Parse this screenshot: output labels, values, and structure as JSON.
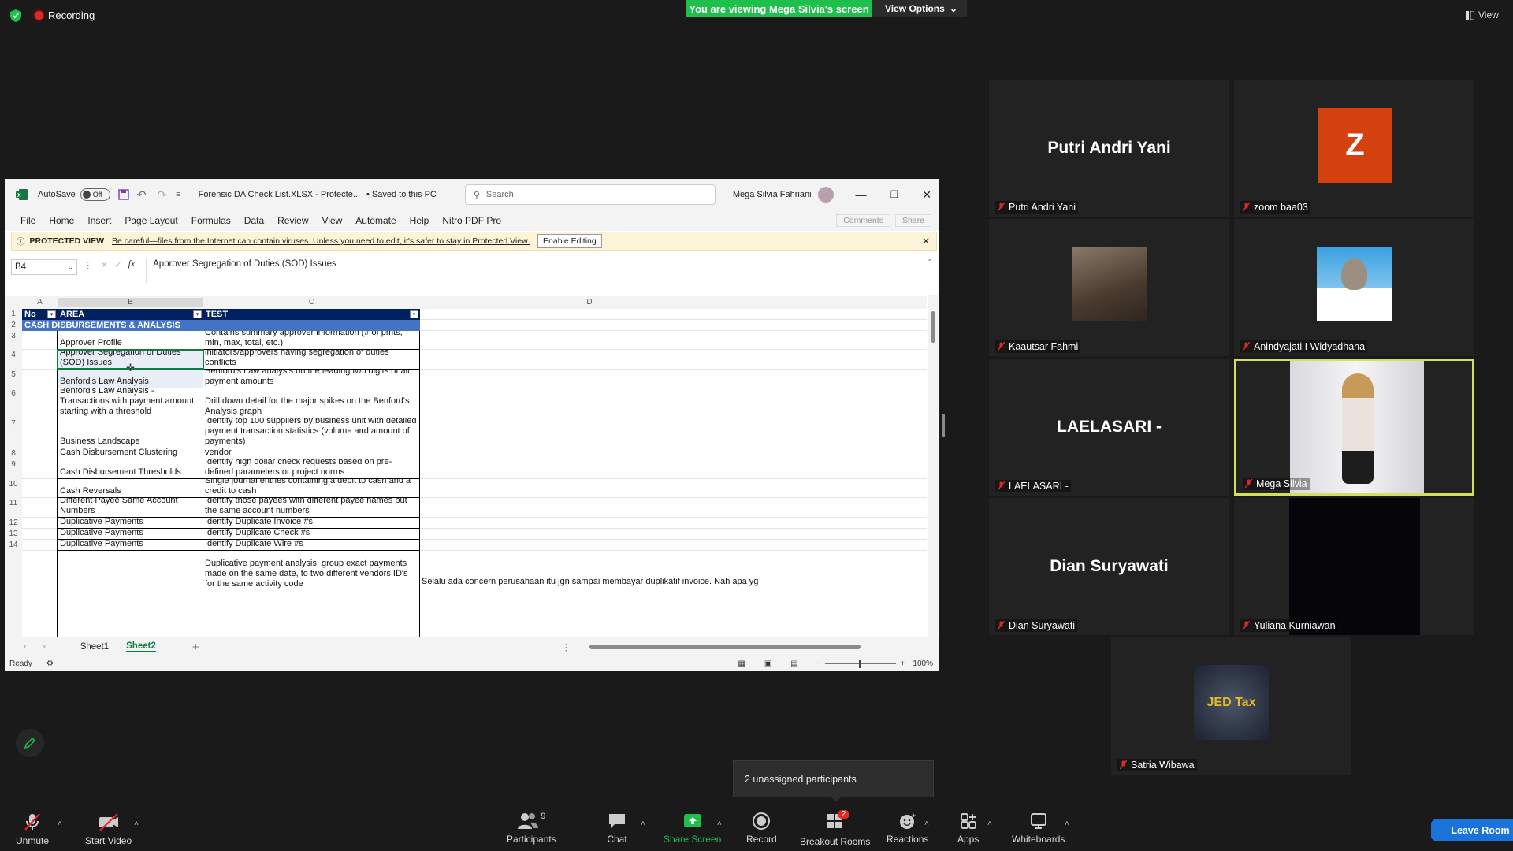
{
  "topbar": {
    "recording": "Recording",
    "viewing": "You are viewing Mega Silvia's screen",
    "view_options": "View Options",
    "view": "View"
  },
  "excel": {
    "autosave": "AutoSave",
    "autosave_state": "Off",
    "filename": "Forensic DA Check List.XLSX  -  Protecte...",
    "saved": "• Saved to this PC",
    "search_placeholder": "Search",
    "user": "Mega Silvia Fahriani",
    "menu": [
      "File",
      "Home",
      "Insert",
      "Page Layout",
      "Formulas",
      "Data",
      "Review",
      "View",
      "Automate",
      "Help",
      "Nitro PDF Pro"
    ],
    "comments": "Comments",
    "share": "Share",
    "protected_title": "PROTECTED VIEW",
    "protected_msg": "Be careful—files from the Internet can contain viruses. Unless you need to edit, it's safer to stay in Protected View.",
    "enable_editing": "Enable Editing",
    "cell_ref": "B4",
    "formula": "Approver Segregation of Duties (SOD) Issues",
    "columns": [
      "A",
      "B",
      "C",
      "D"
    ],
    "header": {
      "no": "No",
      "area": "AREA",
      "test": "TEST"
    },
    "section": "CASH DISBURSEMENTS & ANALYSIS",
    "rows": [
      {
        "n": "1",
        "area": "",
        "test": ""
      },
      {
        "n": "2",
        "area": "",
        "test": ""
      },
      {
        "n": "3",
        "area": "Approver Profile",
        "test": "Contains summary approver information (# of pmts, min, max, total, etc.)"
      },
      {
        "n": "4",
        "area": "Approver Segregation of Duties (SOD) Issues",
        "test": "Contains transaction level information with initiators/approvers having segregation of duties conflicts"
      },
      {
        "n": "5",
        "area": "Benford's Law Analysis",
        "test": "Benford's Law analysis on the leading two digits of all payment amounts"
      },
      {
        "n": "6",
        "area": "Benford's Law Analysis - Transactions with payment amount starting with a threshold",
        "test": "Drill down detail for the major spikes on the Benford's Analysis graph"
      },
      {
        "n": "7",
        "area": "Business Landscape",
        "test": "Identify top 100 suppliers by business unit with detailed payment transaction statistics (volume and amount of payments)"
      },
      {
        "n": "8",
        "area": "Cash Disbursement Clustering",
        "test": "Summarize cash disbursements by account, bank, vendor"
      },
      {
        "n": "9",
        "area": "Cash Disbursement Thresholds",
        "test": "Identify high dollar check requests based on pre-defined parameters or project norms"
      },
      {
        "n": "10",
        "area": "Cash Reversals",
        "test": "Single journal entries containing a debit to cash and a credit to cash"
      },
      {
        "n": "11",
        "area": "Different Payee Same Account Numbers",
        "test": "Identify those payees with different payee names but the same account numbers"
      },
      {
        "n": "12",
        "area": "Duplicative Payments",
        "test": "Identify Duplicate Invoice #s"
      },
      {
        "n": "13",
        "area": "Duplicative Payments",
        "test": "Identify Duplicate Check #s"
      },
      {
        "n": "14",
        "area": "Duplicative Payments",
        "test": "Identify Duplicate Wire #s"
      },
      {
        "n": "",
        "area": "",
        "test": "Duplicative payment analysis: group exact payments made on the same date, to two different vendors ID's for the same activity code"
      }
    ],
    "d15": "Selalu ada concern perusahaan itu jgn sampai membayar duplikatif invoice. Nah apa yg bs kita",
    "sheets": [
      "Sheet1",
      "Sheet2"
    ],
    "status": "Ready",
    "zoom": "100%"
  },
  "participants": [
    {
      "name": "Putri Andri Yani",
      "display": "Putri Andri Yani",
      "kind": "name"
    },
    {
      "name": "zoom baa03",
      "display": "Z",
      "kind": "avatar"
    },
    {
      "name": "Kaautsar Fahmi",
      "display": "",
      "kind": "photo"
    },
    {
      "name": "Anindyajati I Widyadhana",
      "display": "",
      "kind": "photo"
    },
    {
      "name": "LAELASARI -",
      "display": "LAELASARI -",
      "kind": "name"
    },
    {
      "name": "Mega Silvia",
      "display": "",
      "kind": "video"
    },
    {
      "name": "Dian Suryawati",
      "display": "Dian Suryawati",
      "kind": "name"
    },
    {
      "name": "Yuliana Kurniawan",
      "display": "",
      "kind": "dark"
    },
    {
      "name": "Satria Wibawa",
      "display": "JED Tax",
      "kind": "logo"
    }
  ],
  "toolbar": {
    "unmute": "Unmute",
    "start_video": "Start Video",
    "participants": "Participants",
    "participants_count": "9",
    "chat": "Chat",
    "share_screen": "Share Screen",
    "record": "Record",
    "breakout": "Breakout Rooms",
    "breakout_badge": "2",
    "reactions": "Reactions",
    "apps": "Apps",
    "whiteboards": "Whiteboards",
    "leave": "Leave Room"
  },
  "unassigned": "2 unassigned participants",
  "colors": {
    "zoom_green": "#1fbf4c",
    "excel_header": "#002060",
    "section_blue": "#4472c4",
    "leave_blue": "#1a73d9",
    "speaker_border": "#d4e157"
  }
}
